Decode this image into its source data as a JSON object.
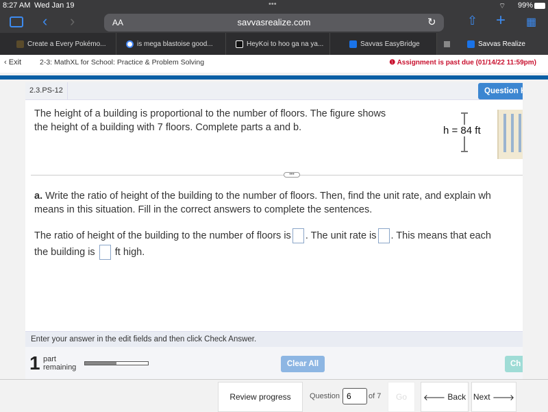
{
  "status_bar": {
    "time": "8:27 AM",
    "date": "Wed Jan 19",
    "battery": "99%"
  },
  "browser": {
    "url": "savvasrealize.com",
    "text_size": "AA",
    "tabs": [
      {
        "label": "Create a Every Pokémo...",
        "color": "#5a4b2b"
      },
      {
        "label": "is mega blastoise good...",
        "color": "#4285f4"
      },
      {
        "label": "HeyKoi to hoo ga na ya...",
        "color": "#111111"
      },
      {
        "label": "Savvas EasyBridge",
        "color": "#1a73e8"
      },
      {
        "label": "Savvas Realize",
        "color": "#1a73e8"
      }
    ]
  },
  "header": {
    "exit": "Exit",
    "title": "2-3: MathXL for School: Practice & Problem Solving",
    "past_due": "Assignment is past due (01/14/22 11:59pm)"
  },
  "question": {
    "id": "2.3.PS-12",
    "help_button": "Question H",
    "text_lines": [
      "The height of a building is proportional to the number of floors. The figure shows",
      "the height of a building with 7 floors. Complete parts a and b."
    ],
    "figure_label": "h = 84 ft",
    "part_a_label": "a.",
    "part_a_lines": [
      " Write the ratio of height of the building to the number of floors. Then, find the unit rate, and explain wh",
      "means in this situation. Fill in the correct answers to complete the sentences."
    ],
    "sentence": {
      "s1": "The ratio of height of the building to the number of floors is",
      "s2": ". The unit rate is",
      "s3": ". This means that each",
      "s4": "the building is",
      "s5": "ft high."
    },
    "instruction": "Enter your answer in the edit fields and then click Check Answer.",
    "parts_remaining": "1",
    "parts_word1": "part",
    "parts_word2": "remaining",
    "progress": 0.5,
    "clear_all": "Clear All",
    "check_answer": "Ch"
  },
  "footer": {
    "review": "Review progress",
    "question_label": "Question",
    "question_value": "6",
    "of": "of 7",
    "go": "Go",
    "back": "Back",
    "next": "Next"
  }
}
